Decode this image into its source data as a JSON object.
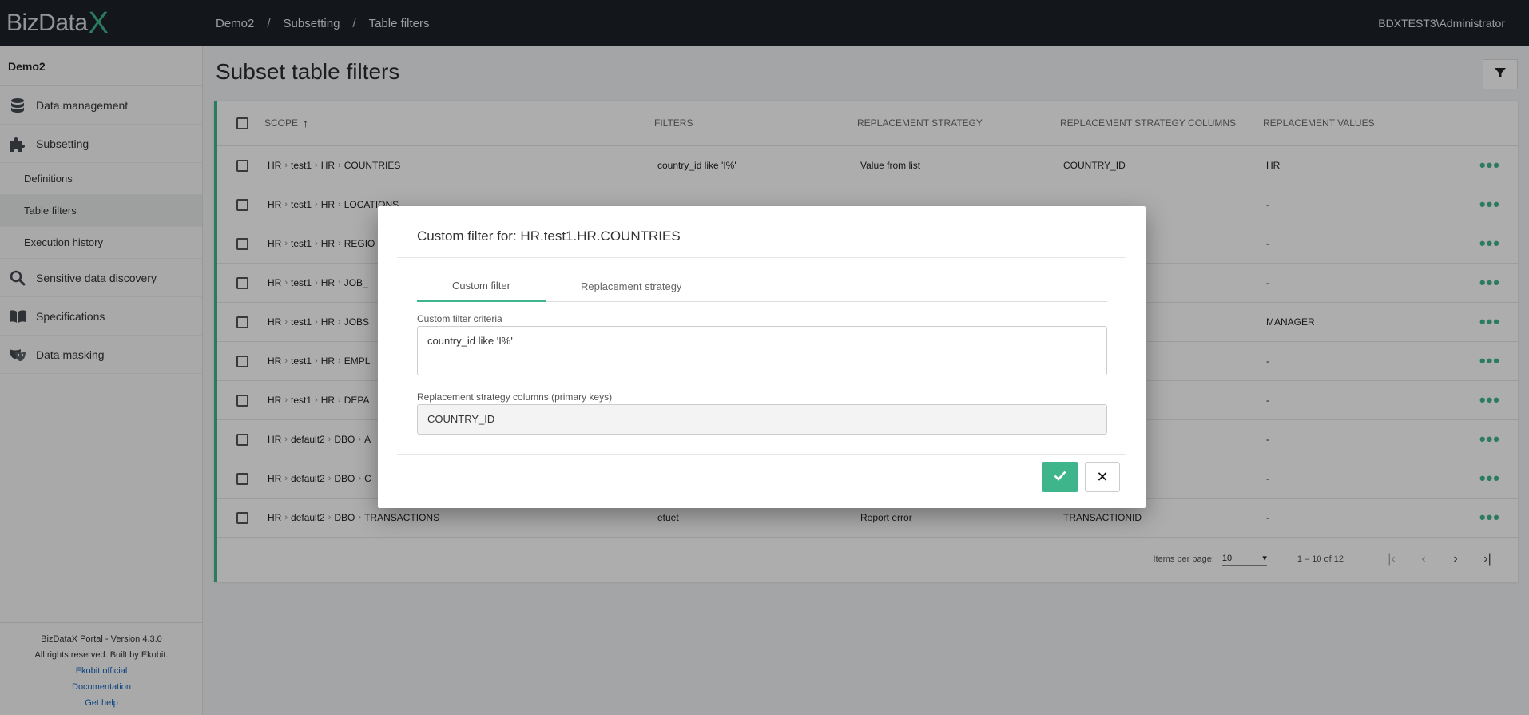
{
  "app": {
    "logo_text": "BizData",
    "logo_x": "X",
    "user": "BDXTEST3\\Administrator"
  },
  "breadcrumb": {
    "items": [
      "Demo2",
      "Subsetting",
      "Table filters"
    ],
    "separator": "/"
  },
  "sidebar": {
    "project": "Demo2",
    "items": [
      {
        "label": "Data management",
        "icon": "database-icon"
      },
      {
        "label": "Subsetting",
        "icon": "puzzle-icon"
      },
      {
        "label": "Definitions"
      },
      {
        "label": "Table filters"
      },
      {
        "label": "Execution history"
      },
      {
        "label": "Sensitive data discovery",
        "icon": "search-icon"
      },
      {
        "label": "Specifications",
        "icon": "book-icon"
      },
      {
        "label": "Data masking",
        "icon": "mask-icon"
      }
    ],
    "footer": {
      "version": "BizDataX Portal - Version 4.3.0",
      "rights": "All rights reserved. Built by Ekobit.",
      "link1": "Ekobit official",
      "link2": "Documentation",
      "link3": "Get help"
    }
  },
  "page": {
    "title": "Subset table filters"
  },
  "table": {
    "headers": {
      "scope": "SCOPE",
      "filters": "FILTERS",
      "strategy": "REPLACEMENT STRATEGY",
      "columns": "REPLACEMENT STRATEGY COLUMNS",
      "values": "REPLACEMENT VALUES"
    },
    "rows": [
      {
        "s1": "HR",
        "s2": "test1",
        "s3": "HR",
        "s4": "COUNTRIES",
        "filters": "country_id like 'I%'",
        "strategy": "Value from list",
        "columns": "COUNTRY_ID",
        "values": "HR"
      },
      {
        "s1": "HR",
        "s2": "test1",
        "s3": "HR",
        "s4": "LOCATIONS",
        "filters": "",
        "strategy": "",
        "columns": "",
        "values": "-"
      },
      {
        "s1": "HR",
        "s2": "test1",
        "s3": "HR",
        "s4": "REGIO",
        "filters": "",
        "strategy": "",
        "columns": "",
        "values": "-"
      },
      {
        "s1": "HR",
        "s2": "test1",
        "s3": "HR",
        "s4": "JOB_",
        "filters": "",
        "strategy": "",
        "columns": "",
        "values": "-"
      },
      {
        "s1": "HR",
        "s2": "test1",
        "s3": "HR",
        "s4": "JOBS",
        "filters": "",
        "strategy": "",
        "columns": "",
        "values": "MANAGER"
      },
      {
        "s1": "HR",
        "s2": "test1",
        "s3": "HR",
        "s4": "EMPL",
        "filters": "",
        "strategy": "",
        "columns": "",
        "values": "-"
      },
      {
        "s1": "HR",
        "s2": "test1",
        "s3": "HR",
        "s4": "DEPA",
        "filters": "",
        "strategy": "",
        "columns": "",
        "values": "-"
      },
      {
        "s1": "HR",
        "s2": "default2",
        "s3": "DBO",
        "s4": "A",
        "filters": "",
        "strategy": "",
        "columns": "",
        "values": "-"
      },
      {
        "s1": "HR",
        "s2": "default2",
        "s3": "DBO",
        "s4": "C",
        "filters": "",
        "strategy": "",
        "columns": "",
        "values": "-"
      },
      {
        "s1": "HR",
        "s2": "default2",
        "s3": "DBO",
        "s4": "TRANSACTIONS",
        "filters": "etuet",
        "strategy": "Report error",
        "columns": "TRANSACTIONID",
        "values": "-"
      }
    ]
  },
  "paginator": {
    "items_per_page_label": "Items per page:",
    "items_per_page": "10",
    "range": "1 – 10 of 12"
  },
  "dialog": {
    "title": "Custom filter for: HR.test1.HR.COUNTRIES",
    "tabs": [
      "Custom filter",
      "Replacement strategy"
    ],
    "criteria_label": "Custom filter criteria",
    "criteria_value": "country_id like 'I%'",
    "columns_label": "Replacement strategy columns (primary keys)",
    "columns_value": "COUNTRY_ID"
  },
  "colors": {
    "accent": "#3fb58c",
    "topbar": "#1d2229"
  }
}
